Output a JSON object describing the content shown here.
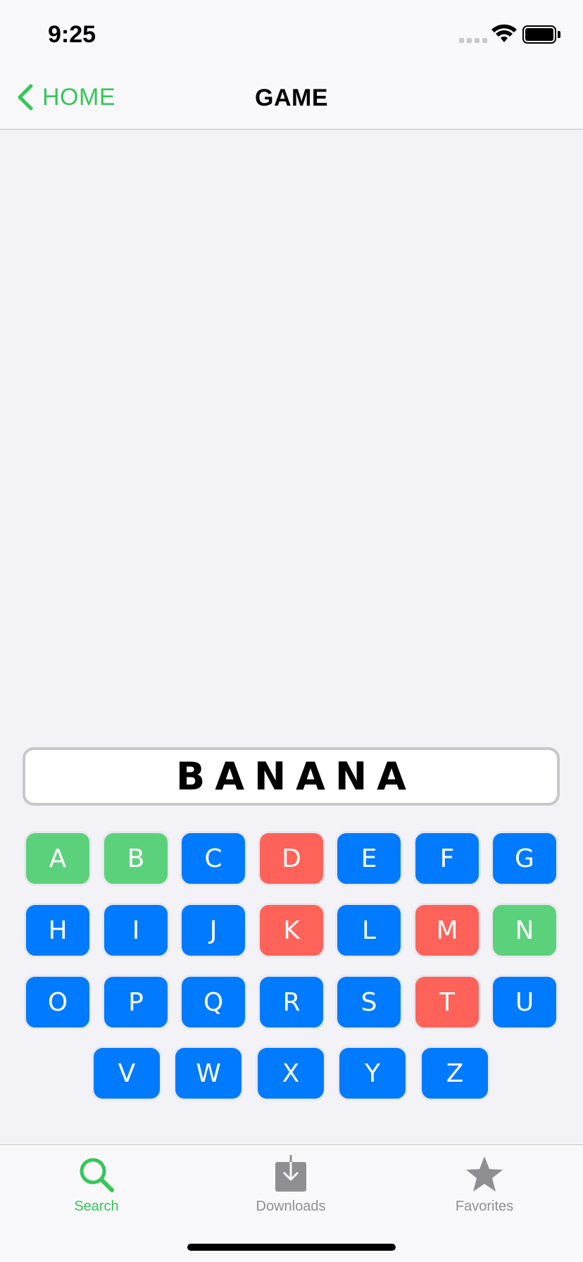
{
  "status_bar": {
    "time": "9:25"
  },
  "nav": {
    "back_label": "HOME",
    "title": "GAME"
  },
  "game": {
    "word": "BANANA"
  },
  "keyboard": {
    "rows": [
      [
        {
          "letter": "A",
          "state": "correct"
        },
        {
          "letter": "B",
          "state": "correct"
        },
        {
          "letter": "C",
          "state": "default"
        },
        {
          "letter": "D",
          "state": "wrong"
        },
        {
          "letter": "E",
          "state": "default"
        },
        {
          "letter": "F",
          "state": "default"
        },
        {
          "letter": "G",
          "state": "default"
        }
      ],
      [
        {
          "letter": "H",
          "state": "default"
        },
        {
          "letter": "I",
          "state": "default"
        },
        {
          "letter": "J",
          "state": "default"
        },
        {
          "letter": "K",
          "state": "wrong"
        },
        {
          "letter": "L",
          "state": "default"
        },
        {
          "letter": "M",
          "state": "wrong"
        },
        {
          "letter": "N",
          "state": "correct"
        }
      ],
      [
        {
          "letter": "O",
          "state": "default"
        },
        {
          "letter": "P",
          "state": "default"
        },
        {
          "letter": "Q",
          "state": "default"
        },
        {
          "letter": "R",
          "state": "default"
        },
        {
          "letter": "S",
          "state": "default"
        },
        {
          "letter": "T",
          "state": "wrong"
        },
        {
          "letter": "U",
          "state": "default"
        }
      ],
      [
        {
          "letter": "V",
          "state": "default"
        },
        {
          "letter": "W",
          "state": "default"
        },
        {
          "letter": "X",
          "state": "default"
        },
        {
          "letter": "Y",
          "state": "default"
        },
        {
          "letter": "Z",
          "state": "default"
        }
      ]
    ]
  },
  "tab_bar": {
    "tabs": [
      {
        "label": "Search",
        "icon": "search-icon",
        "active": true
      },
      {
        "label": "Downloads",
        "icon": "download-icon",
        "active": false
      },
      {
        "label": "Favorites",
        "icon": "star-icon",
        "active": false
      }
    ]
  },
  "colors": {
    "accent": "#34c759",
    "key_default": "#007aff",
    "key_correct": "#5cd17b",
    "key_wrong": "#ff6259"
  }
}
